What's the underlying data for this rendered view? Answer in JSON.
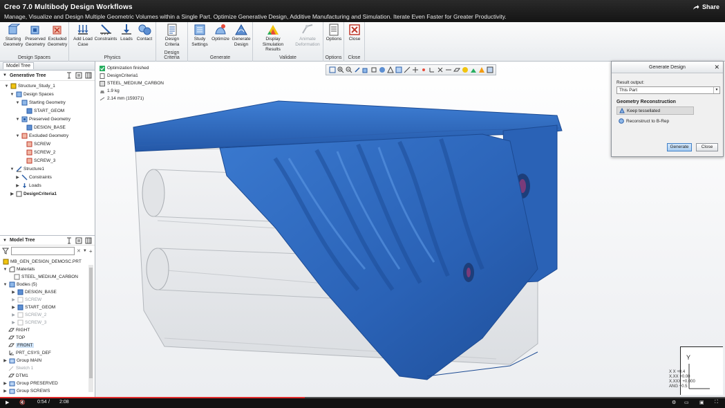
{
  "video": {
    "title": "Creo 7.0 Multibody Design Workflows",
    "subtitle": "Manage, Visualize and Design Multiple Geometric Volumes within a Single Part. Optimize Generative Design, Additive Manufacturing and Simulation. Iterate Even Faster for Greater Productivity.",
    "share_label": "Share",
    "time_current": "0:54",
    "time_total": "2:08",
    "progress": 0.42
  },
  "ribbon": {
    "groups": [
      {
        "label": "Design Spaces",
        "buttons": [
          {
            "l1": "Starting",
            "l2": "Geometry"
          },
          {
            "l1": "Preserved",
            "l2": "Geometry"
          },
          {
            "l1": "Excluded",
            "l2": "Geometry"
          }
        ]
      },
      {
        "label": "Physics",
        "buttons": [
          {
            "l1": "Add Load",
            "l2": "Case"
          },
          {
            "l1": "Constraints",
            "l2": ""
          },
          {
            "l1": "Loads",
            "l2": ""
          },
          {
            "l1": "Contact",
            "l2": ""
          }
        ]
      },
      {
        "label": "Design Criteria",
        "buttons": [
          {
            "l1": "Design",
            "l2": "Criteria"
          }
        ]
      },
      {
        "label": "Generate",
        "buttons": [
          {
            "l1": "Study",
            "l2": "Settings"
          },
          {
            "l1": "Optimize",
            "l2": ""
          },
          {
            "l1": "Generate",
            "l2": "Design"
          }
        ]
      },
      {
        "label": "Validate",
        "buttons": [
          {
            "l1": "Display",
            "l2": "Simulation Results"
          },
          {
            "l1": "Animate",
            "l2": "Deformation"
          }
        ]
      },
      {
        "label": "Options",
        "buttons": [
          {
            "l1": "Options",
            "l2": ""
          }
        ]
      },
      {
        "label": "Close",
        "buttons": [
          {
            "l1": "Close",
            "l2": ""
          }
        ]
      }
    ]
  },
  "gen_tree": {
    "tab": "Model Tree",
    "title": "Generative Tree",
    "items": [
      "Structure_Study_1",
      "Design Spaces",
      "Starting Geometry",
      "START_GEOM",
      "Preserved Geometry",
      "DESIGN_BASE",
      "Excluded Geometry",
      "SCREW",
      "SCREW_2",
      "SCREW_3",
      "Structure1",
      "Constraints",
      "Loads",
      "DesignCriteria1"
    ]
  },
  "model_tree": {
    "title": "Model Tree",
    "filter_value": "",
    "items": [
      "MB_GEN_DESIGN_DEMOSC.PRT",
      "Materials",
      "STEEL_MEDIUM_CARBON",
      "Bodies (5)",
      "DESIGN_BASE",
      "SCREW",
      "START_GEOM",
      "SCREW_2",
      "SCREW_3",
      "RIGHT",
      "TOP",
      "FRONT",
      "PRT_CSYS_DEF",
      "Group MAIN",
      "Sketch 1",
      "DTM1",
      "Group PRESERVED",
      "Group SCREWS"
    ]
  },
  "status": {
    "items": [
      "Optimization finished",
      "DesignCriteria1",
      "STEEL_MEDIUM_CARBON",
      "1.9 kg",
      "2.14 mm (159371)"
    ]
  },
  "dialog": {
    "title": "Generate Design",
    "result_output_label": "Result output:",
    "result_output_value": "This Part",
    "geo_recon_label": "Geometry Reconstruction",
    "opt_keep": "Keep tessellated",
    "opt_reconstruct": "Reconstruct to B-Rep",
    "generate_label": "Generate",
    "close_label": "Close"
  },
  "csys": {
    "y_label": "Y",
    "readout": "X X +0.4\nX.XX +0.00\nX.XXX +0.000\nANG +0.5"
  },
  "colors": {
    "accent_blue": "#2f6fc4",
    "part_blue": "#2b63b8",
    "progress_red": "#e12a2a"
  }
}
